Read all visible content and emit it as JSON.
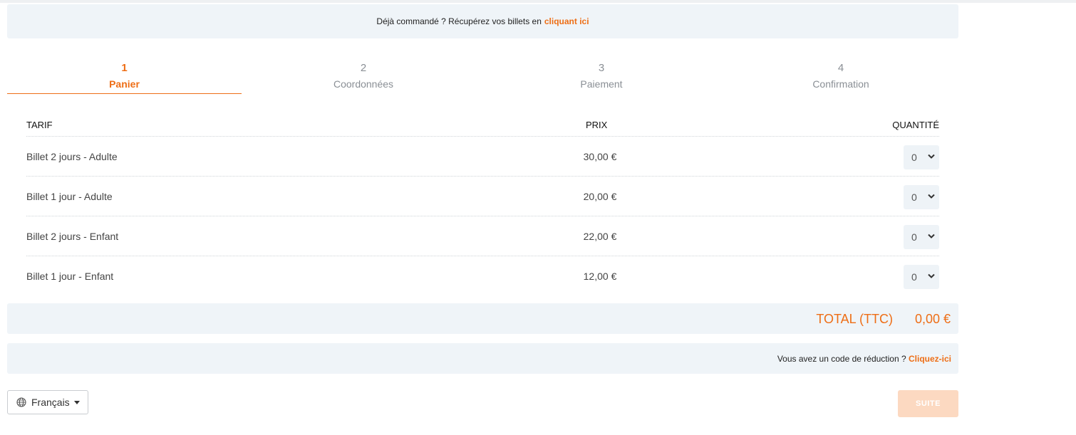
{
  "banner": {
    "text": "Déjà commandé ? Récupérez vos billets en",
    "link": "cliquant ici"
  },
  "steps": [
    {
      "num": "1",
      "label": "Panier"
    },
    {
      "num": "2",
      "label": "Coordonnées"
    },
    {
      "num": "3",
      "label": "Paiement"
    },
    {
      "num": "4",
      "label": "Confirmation"
    }
  ],
  "table": {
    "headers": {
      "tarif": "TARIF",
      "prix": "PRIX",
      "quantite": "QUANTITÉ"
    },
    "rows": [
      {
        "name": "Billet 2 jours - Adulte",
        "price": "30,00 €",
        "qty": "0"
      },
      {
        "name": "Billet 1 jour - Adulte",
        "price": "20,00 €",
        "qty": "0"
      },
      {
        "name": "Billet 2 jours - Enfant",
        "price": "22,00 €",
        "qty": "0"
      },
      {
        "name": "Billet 1 jour - Enfant",
        "price": "12,00 €",
        "qty": "0"
      }
    ]
  },
  "total": {
    "label": "TOTAL (TTC)",
    "amount": "0,00 €"
  },
  "promo": {
    "text": "Vous avez un code de réduction ?",
    "link": "Cliquez-ici"
  },
  "language": {
    "label": "Français",
    "icon": "globe-icon"
  },
  "next_button": {
    "label": "SUITE"
  },
  "colors": {
    "accent": "#ee6e16",
    "panel": "#eff4f8",
    "button_disabled": "#fcd9c1"
  }
}
